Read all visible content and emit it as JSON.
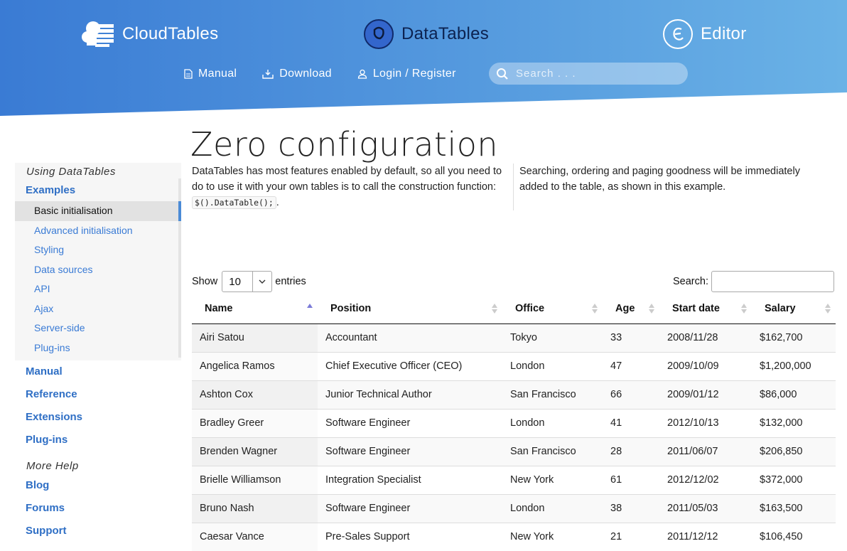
{
  "brand": {
    "cloudtables": "CloudTables",
    "datatables": "DataTables",
    "editor": "Editor"
  },
  "nav": {
    "manual": "Manual",
    "download": "Download",
    "login": "Login / Register",
    "search_placeholder": "Search . . ."
  },
  "colors": {
    "header_start": "#3d7fd6",
    "header_end": "#6cb1e6",
    "link": "#2f6fc5",
    "sidebar_bg": "#f6f6f6"
  },
  "sidebar": {
    "heading": "Using DataTables",
    "category": "Examples",
    "items": [
      {
        "label": "Basic initialisation",
        "active": true
      },
      {
        "label": "Advanced initialisation"
      },
      {
        "label": "Styling"
      },
      {
        "label": "Data sources"
      },
      {
        "label": "API"
      },
      {
        "label": "Ajax"
      },
      {
        "label": "Server-side"
      },
      {
        "label": "Plug-ins"
      }
    ],
    "links": [
      "Manual",
      "Reference",
      "Extensions",
      "Plug-ins"
    ],
    "help_heading": "More Help",
    "help_links": [
      "Blog",
      "Forums",
      "Support"
    ]
  },
  "page": {
    "title": "Zero configuration",
    "intro_left_1": "DataTables has most features enabled by default, so all you need to do to use it with your own tables is to call the construction function: ",
    "intro_code": "$().DataTable();",
    "intro_left_2": ".",
    "intro_right": "Searching, ordering and paging goodness will be immediately added to the table, as shown in this example."
  },
  "table_controls": {
    "show_label": "Show",
    "page_length": "10",
    "entries_label": "entries",
    "search_label": "Search:"
  },
  "table": {
    "columns": [
      "Name",
      "Position",
      "Office",
      "Age",
      "Start date",
      "Salary"
    ],
    "rows": [
      [
        "Airi Satou",
        "Accountant",
        "Tokyo",
        "33",
        "2008/11/28",
        "$162,700"
      ],
      [
        "Angelica Ramos",
        "Chief Executive Officer (CEO)",
        "London",
        "47",
        "2009/10/09",
        "$1,200,000"
      ],
      [
        "Ashton Cox",
        "Junior Technical Author",
        "San Francisco",
        "66",
        "2009/01/12",
        "$86,000"
      ],
      [
        "Bradley Greer",
        "Software Engineer",
        "London",
        "41",
        "2012/10/13",
        "$132,000"
      ],
      [
        "Brenden Wagner",
        "Software Engineer",
        "San Francisco",
        "28",
        "2011/06/07",
        "$206,850"
      ],
      [
        "Brielle Williamson",
        "Integration Specialist",
        "New York",
        "61",
        "2012/12/02",
        "$372,000"
      ],
      [
        "Bruno Nash",
        "Software Engineer",
        "London",
        "38",
        "2011/05/03",
        "$163,500"
      ],
      [
        "Caesar Vance",
        "Pre-Sales Support",
        "New York",
        "21",
        "2011/12/12",
        "$106,450"
      ]
    ]
  }
}
